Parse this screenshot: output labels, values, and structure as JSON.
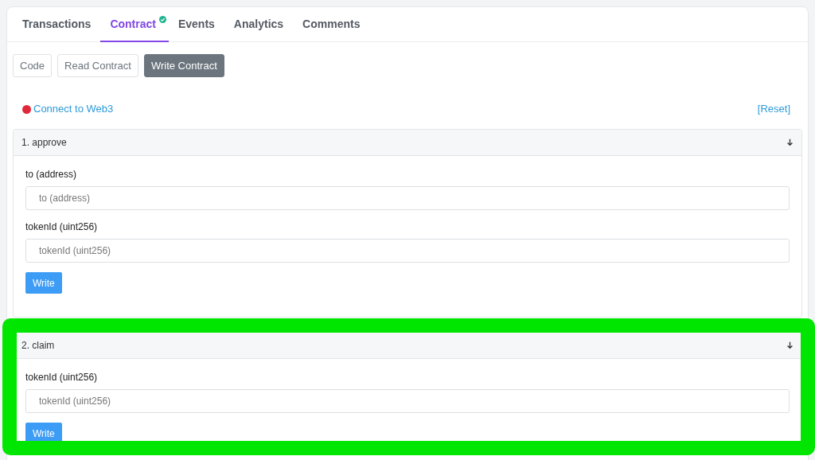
{
  "tabs": [
    {
      "label": "Transactions",
      "selected": false,
      "verified": false
    },
    {
      "label": "Contract",
      "selected": true,
      "verified": true
    },
    {
      "label": "Events",
      "selected": false,
      "verified": false
    },
    {
      "label": "Analytics",
      "selected": false,
      "verified": false
    },
    {
      "label": "Comments",
      "selected": false,
      "verified": false
    }
  ],
  "sub_tabs": [
    {
      "label": "Code",
      "selected": false
    },
    {
      "label": "Read Contract",
      "selected": false
    },
    {
      "label": "Write Contract",
      "selected": true
    }
  ],
  "connection": {
    "label": "Connect to Web3",
    "color": "#e0283a"
  },
  "reset_link": "[Reset]",
  "functions": [
    {
      "title": "1. approve",
      "highlighted": false,
      "inputs": [
        {
          "label": "to (address)",
          "placeholder": "to (address)"
        },
        {
          "label": "tokenId (uint256)",
          "placeholder": "tokenId (uint256)"
        }
      ],
      "button": "Write"
    },
    {
      "title": "2. claim",
      "highlighted": true,
      "inputs": [
        {
          "label": "tokenId (uint256)",
          "placeholder": "tokenId (uint256)"
        }
      ],
      "button": "Write"
    }
  ]
}
